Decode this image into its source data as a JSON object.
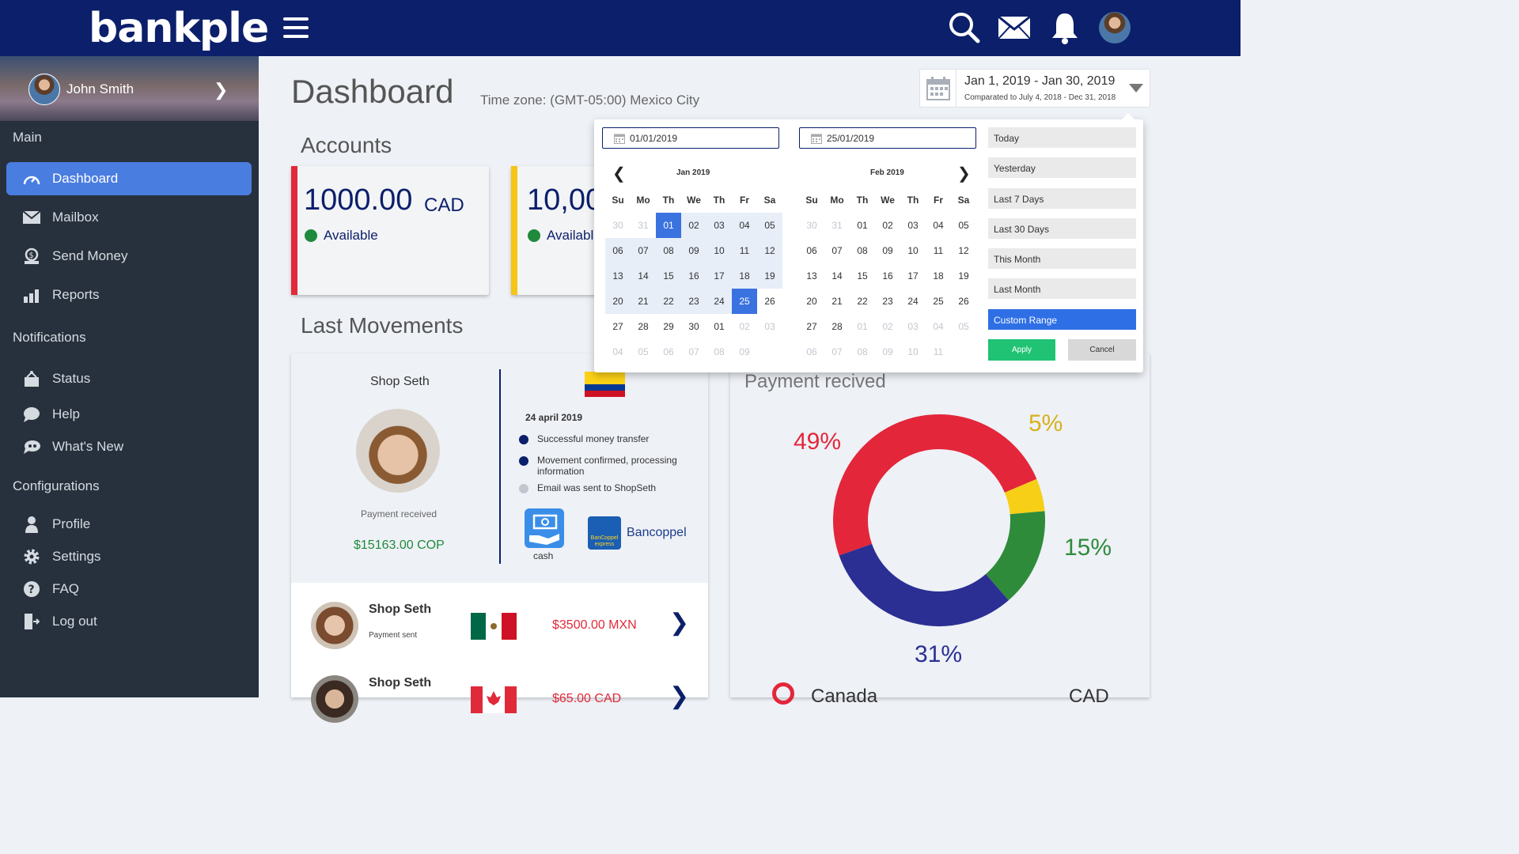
{
  "header": {
    "logo": "bankple"
  },
  "sidebar": {
    "user_name": "John Smith",
    "section_main": "Main",
    "section_notifications": "Notifications",
    "section_configurations": "Configurations",
    "items": [
      {
        "label": "Dashboard",
        "icon": "dashboard-gauge-icon"
      },
      {
        "label": "Mailbox",
        "icon": "envelope-icon"
      },
      {
        "label": "Send Money",
        "icon": "money-send-icon"
      },
      {
        "label": "Reports",
        "icon": "bar-chart-icon"
      },
      {
        "label": "Status",
        "icon": "status-icon"
      },
      {
        "label": "Help",
        "icon": "chat-bubble-icon"
      },
      {
        "label": "What's New",
        "icon": "megaphone-icon"
      },
      {
        "label": "Profile",
        "icon": "user-icon"
      },
      {
        "label": "Settings",
        "icon": "gear-icon"
      },
      {
        "label": "FAQ",
        "icon": "question-icon"
      },
      {
        "label": "Log out",
        "icon": "logout-door-icon"
      }
    ]
  },
  "page": {
    "title": "Dashboard",
    "timezone": "Time zone: (GMT-05:00) Mexico City"
  },
  "date_range": {
    "range": "Jan 1, 2019 - Jan 30, 2019",
    "compare": "Comparated to July 4, 2018 - Dec 31, 2018"
  },
  "accounts": {
    "title": "Accounts",
    "cards": [
      {
        "amount": "1000.00",
        "currency": "CAD",
        "status": "Available",
        "stripe": "#e02a3a"
      },
      {
        "amount": "10,00",
        "currency": "",
        "status": "Available",
        "stripe": "#f5c518"
      }
    ]
  },
  "movements": {
    "title": "Last Movements",
    "detail": {
      "shop": "Shop Seth",
      "status": "Payment received",
      "amount": "$15163.00 COP",
      "date": "24 april 2019",
      "steps": [
        {
          "text": "Successful money transfer",
          "color": "#0b1f6b"
        },
        {
          "text": "Movement confirmed, processing information",
          "color": "#0b1f6b"
        },
        {
          "text": "Email was sent to ShopSeth",
          "color": "#c2c7cf"
        }
      ],
      "method_cash": "cash",
      "bank_logo_text": "BanCoppel express",
      "bank_name": "Bancoppel"
    },
    "rows": [
      {
        "name": "Shop Seth",
        "status": "Payment sent",
        "amount": "$3500.00 MXN",
        "flag": "mexico-flag"
      },
      {
        "name": "Shop Seth",
        "status": "",
        "amount": "$65.00 CAD",
        "flag": "canada-flag"
      }
    ]
  },
  "payments": {
    "title": "Payment recived",
    "legend_country": "Canada",
    "legend_currency": "CAD"
  },
  "chart_data": {
    "type": "pie",
    "categories": [
      "Red",
      "Yellow",
      "Green",
      "Blue"
    ],
    "values": [
      49,
      5,
      15,
      31
    ],
    "labels": [
      "49%",
      "5%",
      "15%",
      "31%"
    ],
    "colors": [
      "#e3263a",
      "#f7cf16",
      "#2e8b3a",
      "#2b2f93"
    ]
  },
  "datepicker": {
    "start_input": "01/01/2019",
    "end_input": "25/01/2019",
    "left_month": "Jan 2019",
    "right_month": "Feb 2019",
    "weekdays": [
      "Su",
      "Mo",
      "Th",
      "We",
      "Th",
      "Fr",
      "Sa"
    ],
    "ranges": [
      "Today",
      "Yesterday",
      "Last 7 Days",
      "Last 30 Days",
      "This Month",
      "Last Month",
      "Custom Range"
    ],
    "active_range": "Custom Range",
    "apply": "Apply",
    "cancel": "Cancel",
    "jan_days": [
      "30",
      "31",
      "01",
      "02",
      "03",
      "04",
      "05",
      "06",
      "07",
      "08",
      "09",
      "10",
      "11",
      "12",
      "13",
      "14",
      "15",
      "16",
      "17",
      "18",
      "19",
      "20",
      "21",
      "22",
      "23",
      "24",
      "25",
      "26",
      "27",
      "28",
      "29",
      "30",
      "01",
      "02",
      "03",
      "04",
      "05",
      "06",
      "07",
      "08",
      "09"
    ],
    "feb_days": [
      "30",
      "31",
      "01",
      "02",
      "03",
      "04",
      "05",
      "06",
      "07",
      "08",
      "09",
      "10",
      "11",
      "12",
      "13",
      "14",
      "15",
      "16",
      "17",
      "18",
      "19",
      "20",
      "21",
      "22",
      "23",
      "24",
      "25",
      "26",
      "27",
      "28",
      "01",
      "02",
      "03",
      "04",
      "05",
      "06",
      "07",
      "08",
      "09",
      "10",
      "11"
    ]
  }
}
